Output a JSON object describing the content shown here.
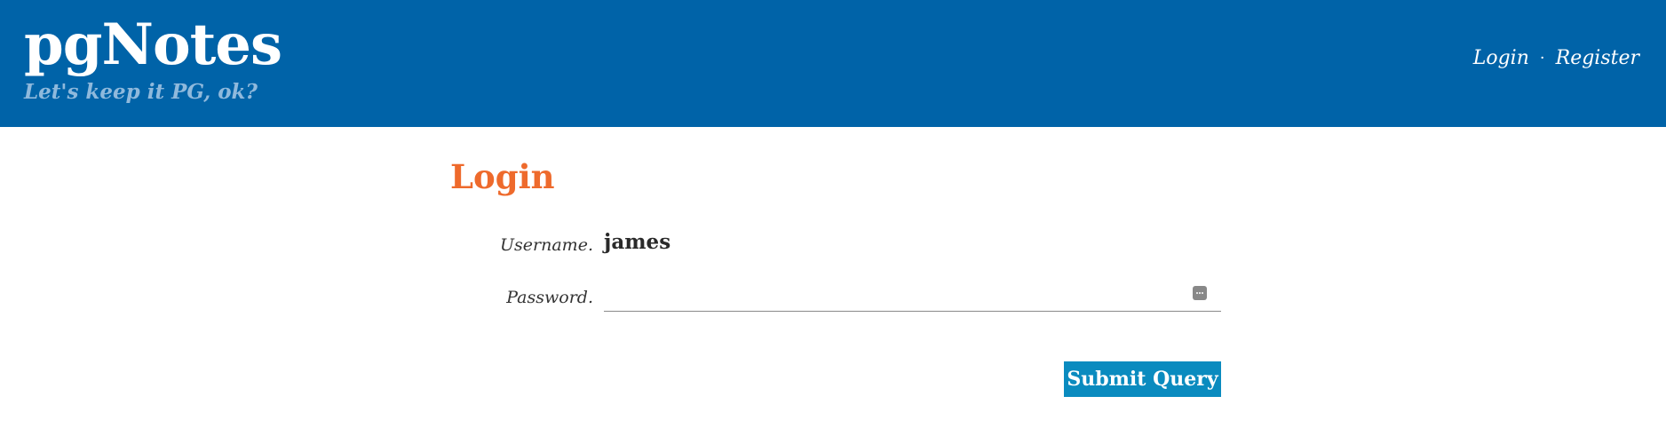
{
  "header": {
    "site_title": "pgNotes",
    "tagline": "Let's keep it PG, ok?",
    "nav": {
      "login": "Login",
      "separator": "·",
      "register": "Register"
    },
    "background_color": "#0063a8"
  },
  "login_form": {
    "title": "Login",
    "username_label": "Username.",
    "username_value": "james",
    "password_label": "Password.",
    "password_value": "",
    "submit_label": "Submit Query",
    "title_color": "#ee6a2c",
    "button_color": "#0a8bbf"
  },
  "icons": {
    "password_manager": "password-manager-icon"
  }
}
